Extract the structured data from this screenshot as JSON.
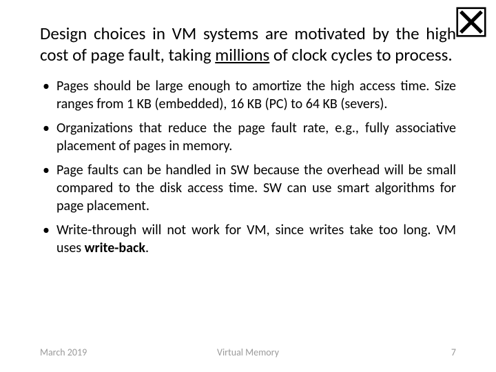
{
  "logo_name": "technion-aleph-logo",
  "title_html": "Design choices in VM systems are motivated by the high cost of page fault, taking <span class=\"u\">millions</span> of clock cycles to process.",
  "bullets": [
    "Pages should be large enough to amortize the high access time. Size ranges from 1 KB (embedded), 16 KB (PC) to 64 KB (severs).",
    "Organizations that reduce the page fault rate, e.g., fully associative placement of pages in memory.",
    "Page faults can be handled in SW because the overhead will be small compared to the disk access time. SW can use smart algorithms for page placement.",
    "Write-through will not work for VM, since writes take too long. VM uses <span class=\"b\">write-back</span>."
  ],
  "footer": {
    "left": "March 2019",
    "center": "Virtual Memory",
    "right": "7"
  }
}
